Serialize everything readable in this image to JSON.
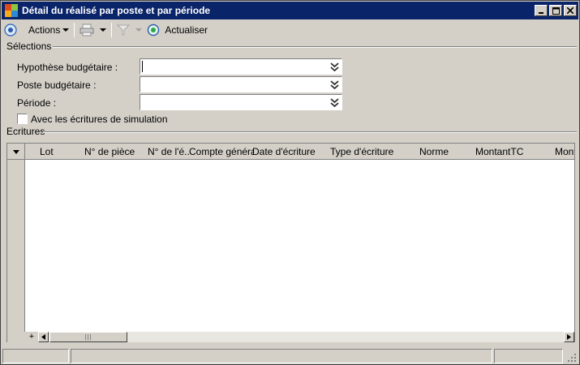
{
  "window": {
    "title": "Détail du réalisé par poste et par période"
  },
  "toolbar": {
    "actions_label": "Actions",
    "refresh_label": "Actualiser"
  },
  "selections": {
    "group_title": "Sélections",
    "fields": [
      {
        "label": "Hypothèse budgétaire :",
        "value": ""
      },
      {
        "label": "Poste budgétaire :",
        "value": ""
      },
      {
        "label": "Période :",
        "value": ""
      }
    ],
    "simulation_checkbox": {
      "label": "Avec les écritures de simulation",
      "checked": false
    }
  },
  "entries": {
    "group_title": "Ecritures",
    "columns": [
      "Lot",
      "N° de pièce",
      "N° de l'é...",
      "Compte général",
      "Date d'écriture",
      "Type d'écriture",
      "Norme",
      "MontantTC",
      "Mont"
    ],
    "rows": []
  },
  "grid_footer": {
    "add_label": "+",
    "thumb_grip": "|||"
  },
  "colors": {
    "titlebar": "#0a246a",
    "face": "#d4d0c8"
  }
}
